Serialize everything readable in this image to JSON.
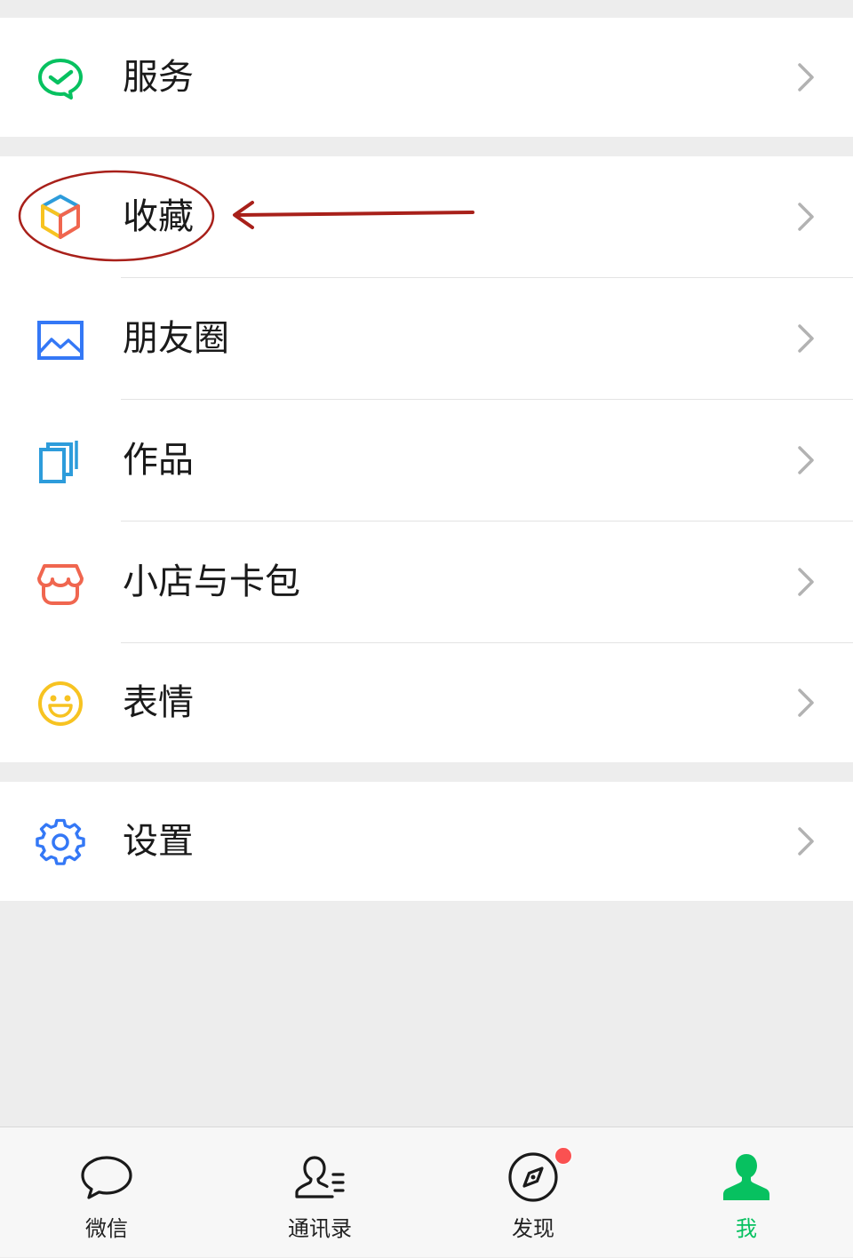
{
  "menu": {
    "services": {
      "label": "服务",
      "icon": "wechat-pay-check-icon",
      "color": "#07c160"
    },
    "favorites": {
      "label": "收藏",
      "icon": "cube-box-icon"
    },
    "moments": {
      "label": "朋友圈",
      "icon": "photo-landscape-icon",
      "color": "#3478f6"
    },
    "works": {
      "label": "作品",
      "icon": "stacked-cards-icon",
      "color": "#2d9cdb"
    },
    "store_cards": {
      "label": "小店与卡包",
      "icon": "shop-awning-icon",
      "color": "#f0664f"
    },
    "stickers": {
      "label": "表情",
      "icon": "smiley-face-icon",
      "color": "#f7c321"
    },
    "settings": {
      "label": "设置",
      "icon": "gear-icon",
      "color": "#3478f6"
    }
  },
  "annotation": {
    "type": "circle-and-arrow",
    "target": "favorites",
    "color": "#a8201a"
  },
  "tabbar": {
    "chats": {
      "label": "微信",
      "icon": "chat-bubble-icon"
    },
    "contacts": {
      "label": "通讯录",
      "icon": "contacts-person-icon"
    },
    "discover": {
      "label": "发现",
      "icon": "compass-icon",
      "badge": "dot",
      "badge_color": "#fa5151"
    },
    "me": {
      "label": "我",
      "icon": "person-filled-icon",
      "active": true,
      "color": "#07c160"
    }
  }
}
